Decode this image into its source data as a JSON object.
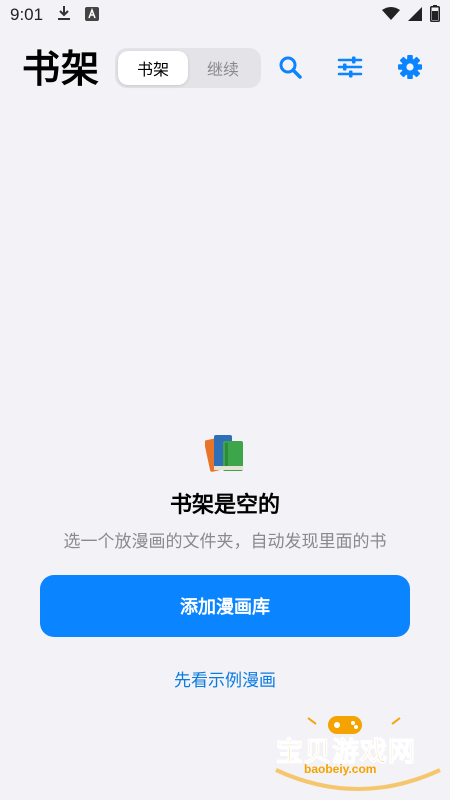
{
  "status_bar": {
    "time": "9:01",
    "icons": [
      "download-icon",
      "a-badge-icon",
      "wifi-icon",
      "signal-icon",
      "battery-icon"
    ]
  },
  "header": {
    "title": "书架",
    "tabs": [
      {
        "label": "书架",
        "active": true
      },
      {
        "label": "继续",
        "active": false
      }
    ],
    "actions": [
      "search-icon",
      "filter-icon",
      "settings-icon"
    ]
  },
  "empty_state": {
    "illustration": "books-icon",
    "title": "书架是空的",
    "subtitle": "选一个放漫画的文件夹，自动发现里面的书",
    "primary_button": "添加漫画库",
    "secondary_link": "先看示例漫画"
  },
  "watermark": {
    "text": "宝贝游戏网",
    "url": "baobeiy.com"
  },
  "colors": {
    "background": "#F2F2F7",
    "accent": "#0A84FF",
    "link": "#0A7BE0",
    "muted": "#8A8A8E",
    "watermark": "#F5A300"
  }
}
